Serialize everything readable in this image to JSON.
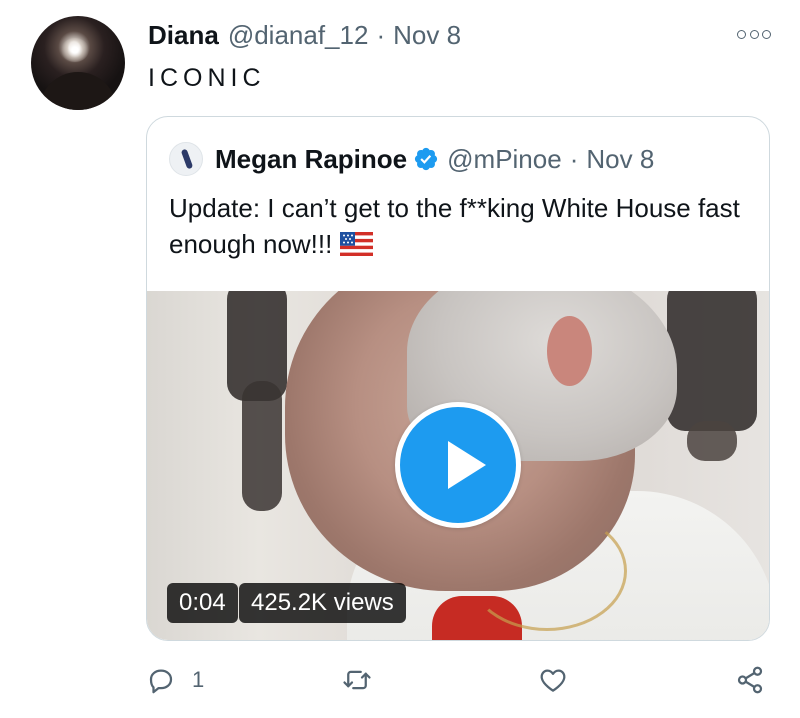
{
  "tweet": {
    "display_name": "Diana",
    "handle": "@dianaf_12",
    "separator": "·",
    "date": "Nov 8",
    "text": "ICONIC",
    "more_icon": "more-options-icon"
  },
  "quoted_tweet": {
    "display_name": "Megan Rapinoe",
    "verified": true,
    "handle": "@mPinoe",
    "separator": "·",
    "date": "Nov 8",
    "text": "Update: I can’t get to the f**king White House fast enough now!!!",
    "emoji": "us-flag-emoji",
    "video": {
      "duration": "0:04",
      "views": "425.2K views",
      "play_icon": "play-icon"
    }
  },
  "actions": {
    "reply_count": "1",
    "reply_icon": "reply-icon",
    "retweet_icon": "retweet-icon",
    "like_icon": "heart-icon",
    "share_icon": "share-icon"
  },
  "colors": {
    "accent": "#1d9bf0",
    "secondary_text": "#536471",
    "border": "#cfd9de"
  }
}
